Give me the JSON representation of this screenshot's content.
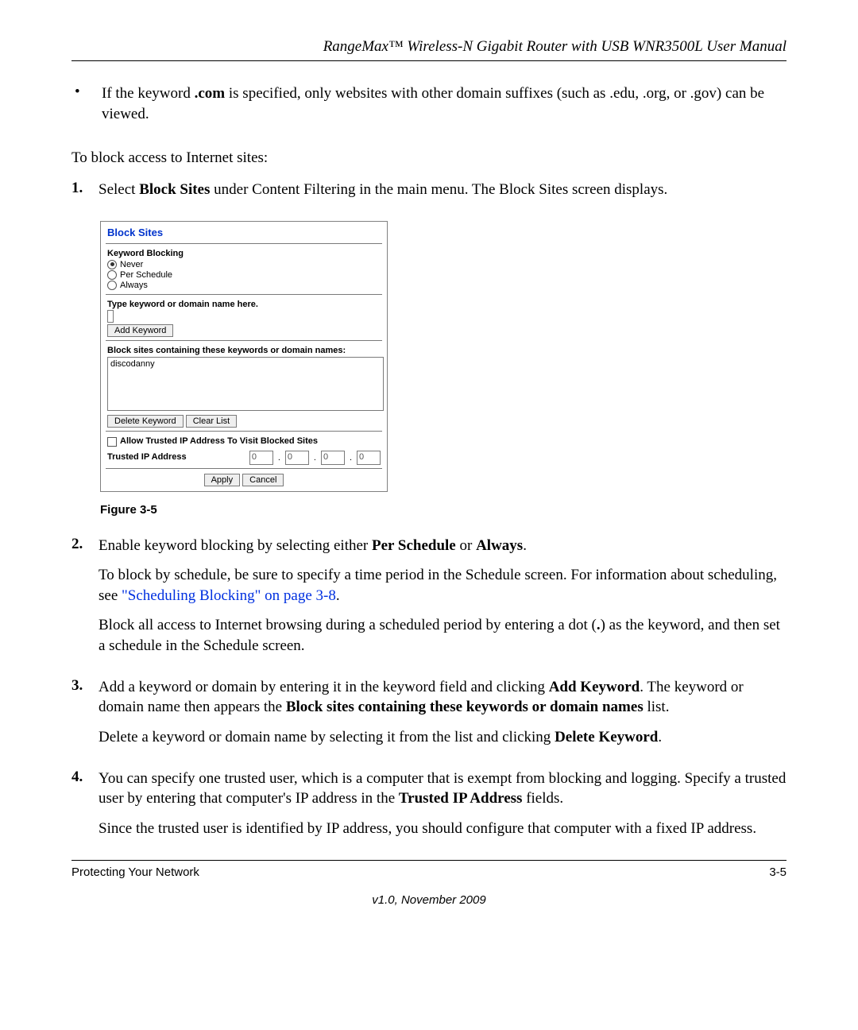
{
  "header": {
    "running": "RangeMax™ Wireless-N Gigabit Router with USB WNR3500L User Manual"
  },
  "bullet": {
    "pre": "If the keyword ",
    "kw": ".com",
    "post": " is specified, only websites with other domain suffixes (such as .edu, .org, or .gov) can be viewed."
  },
  "intro": "To block access to Internet sites:",
  "step1": {
    "num": "1.",
    "pre": "Select ",
    "b1": "Block Sites",
    "post": " under Content Filtering in the main menu. The Block Sites screen displays."
  },
  "panel": {
    "title": "Block Sites",
    "kb_heading": "Keyword Blocking",
    "opt_never": "Never",
    "opt_per": "Per Schedule",
    "opt_always": "Always",
    "type_label": "Type keyword or domain name here.",
    "add_keyword": "Add Keyword",
    "list_label": "Block sites containing these keywords or domain names:",
    "list_value": "discodanny",
    "delete_keyword": "Delete Keyword",
    "clear_list": "Clear List",
    "allow_trusted": "Allow Trusted IP Address To Visit Blocked Sites",
    "trusted_label": "Trusted IP Address",
    "ip0": "0",
    "ip1": "0",
    "ip2": "0",
    "ip3": "0",
    "apply": "Apply",
    "cancel": "Cancel"
  },
  "figure_caption": "Figure 3-5",
  "step2": {
    "num": "2.",
    "l1_pre": "Enable keyword blocking by selecting either ",
    "l1_b1": "Per Schedule",
    "l1_mid": " or ",
    "l1_b2": "Always",
    "l1_end": ".",
    "l2_pre": "To block by schedule, be sure to specify a time period in the Schedule screen. For information about scheduling, see ",
    "l2_link": "\"Scheduling Blocking\" on page 3-8",
    "l2_end": ".",
    "l3_pre": "Block all access to Internet browsing during a scheduled period by entering a dot (",
    "l3_dot": ".",
    "l3_post": ") as the keyword, and then set a schedule in the Schedule screen."
  },
  "step3": {
    "num": "3.",
    "l1_pre": "Add a keyword or domain by entering it in the keyword field and clicking ",
    "l1_b1": "Add Keyword",
    "l1_mid": ". The keyword or domain name then appears the ",
    "l1_b2": "Block sites containing these keywords or domain names",
    "l1_end": " list.",
    "l2_pre": "Delete a keyword or domain name by selecting it from the list and clicking ",
    "l2_b1": "Delete Keyword",
    "l2_end": "."
  },
  "step4": {
    "num": "4.",
    "l1_pre": "You can specify one trusted user, which is a computer that is exempt from blocking and logging. Specify a trusted user by entering that computer's IP address in the ",
    "l1_b1": "Trusted IP Address",
    "l1_end": " fields.",
    "l2": "Since the trusted user is identified by IP address, you should configure that computer with a fixed IP address."
  },
  "footer": {
    "left": "Protecting Your Network",
    "right": "3-5",
    "version": "v1.0, November 2009"
  }
}
